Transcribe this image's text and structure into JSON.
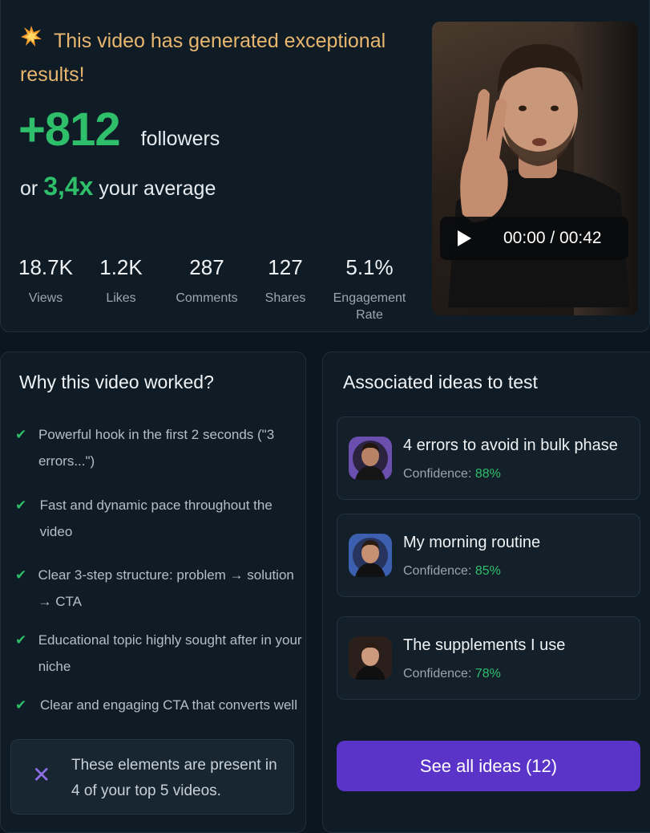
{
  "summary": {
    "headline": "This video has generated exceptional results!",
    "followers_gain": "+812",
    "followers_unit": "followers",
    "avg_prefix": "or",
    "avg_multiplier": "3,4x",
    "avg_suffix": "your average"
  },
  "stats": [
    {
      "value": "18.7K",
      "label": "Views"
    },
    {
      "value": "1.2K",
      "label": "Likes"
    },
    {
      "value": "287",
      "label": "Comments"
    },
    {
      "value": "127",
      "label": "Shares"
    },
    {
      "value": "5.1%",
      "label": "Engagement Rate"
    }
  ],
  "video": {
    "time": "00:00 / 00:42"
  },
  "why": {
    "title": "Why this video worked?",
    "reasons": [
      "Powerful hook in the first 2 seconds (\"3 errors...\")",
      "Fast and dynamic pace throughout the video",
      "Clear 3-step structure: problem → solution → CTA",
      "Educational topic highly sought after in your niche",
      "Clear and engaging CTA that converts well"
    ],
    "note": "These elements are present in 4 of your top 5 videos."
  },
  "ideas": {
    "title": "Associated ideas to test",
    "confidence_label": "Confidence:",
    "items": [
      {
        "title": "4 errors to avoid in bulk phase",
        "confidence": "88%"
      },
      {
        "title": "My morning routine",
        "confidence": "85%"
      },
      {
        "title": "The supplements I use",
        "confidence": "78%"
      }
    ],
    "see_all": "See all ideas (12)"
  },
  "colors": {
    "accent_green": "#2fbe6a",
    "headline_gold": "#e8b66e",
    "button_purple": "#5a33c8"
  },
  "icons": [
    "explosion-icon",
    "play-icon",
    "check-icon",
    "close-x-icon"
  ]
}
